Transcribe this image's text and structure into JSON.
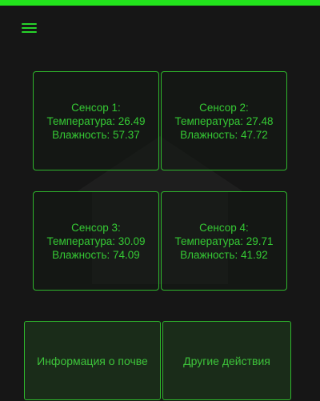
{
  "colors": {
    "accent": "#22e41c",
    "text": "#35c934",
    "border": "#2fb62c",
    "background": "#161616",
    "button_bg": "#1a2c19"
  },
  "header": {
    "menu_icon": "hamburger-menu-icon"
  },
  "background_icon": "house-icon",
  "sensors": [
    {
      "title": "Сенсор 1:",
      "temperature": "Температура: 26.49",
      "humidity": "Влажность: 57.37"
    },
    {
      "title": "Сенсор 2:",
      "temperature": "Температура: 27.48",
      "humidity": "Влажность: 47.72"
    },
    {
      "title": "Сенсор 3:",
      "temperature": "Температура: 30.09",
      "humidity": "Влажность: 74.09"
    },
    {
      "title": "Сенсор 4:",
      "temperature": "Температура: 29.71",
      "humidity": "Влажность: 41.92"
    }
  ],
  "actions": {
    "soil_info_label": "Информация о почве",
    "other_actions_label": "Другие действия"
  }
}
